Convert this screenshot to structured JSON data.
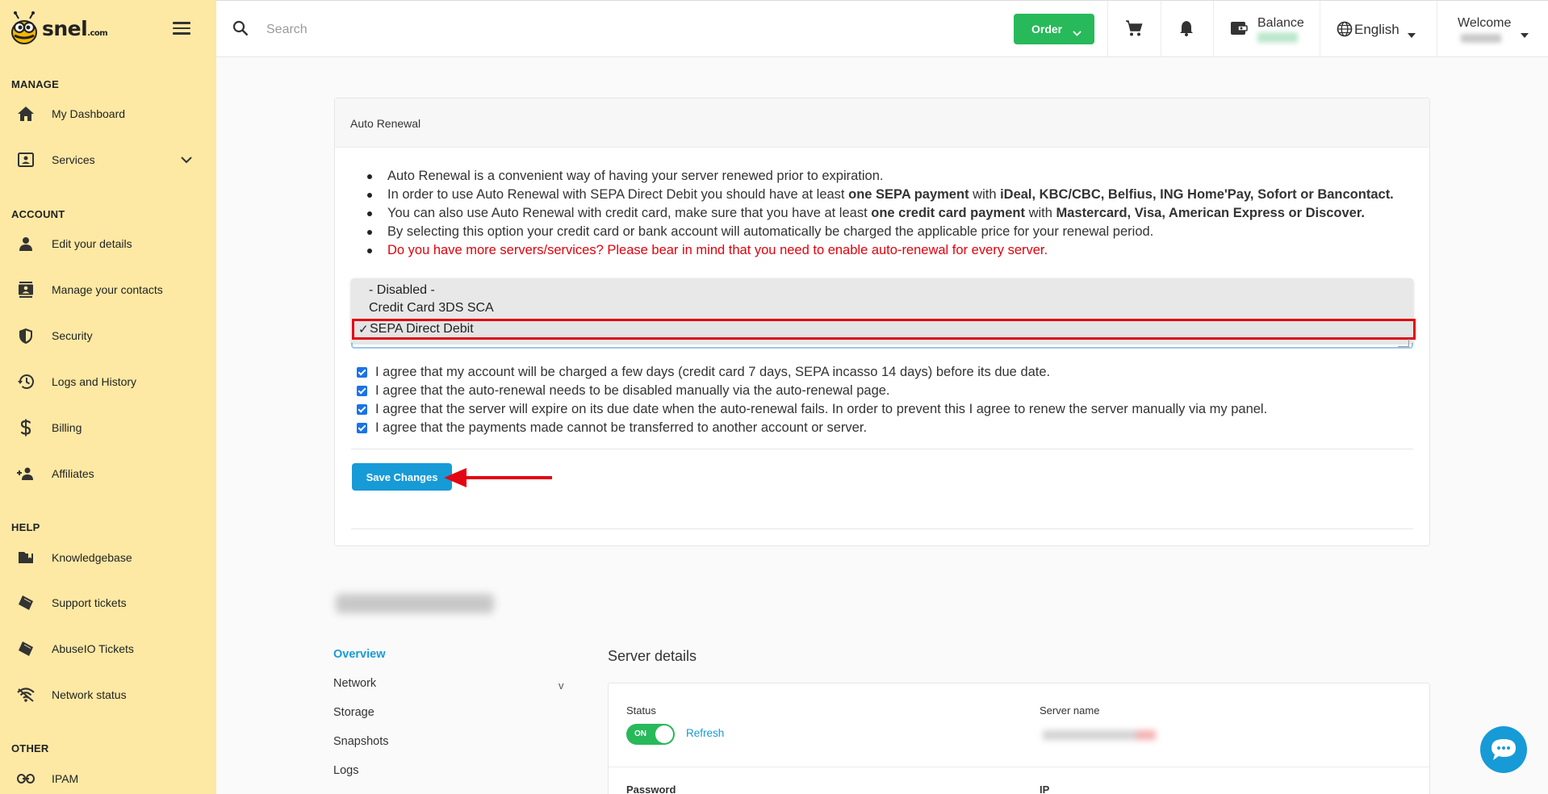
{
  "brand": {
    "name": "snel",
    "suffix": ".com"
  },
  "sidebar": {
    "sections": [
      {
        "title": "MANAGE"
      },
      {
        "title": "ACCOUNT"
      },
      {
        "title": "HELP"
      },
      {
        "title": "OTHER"
      }
    ],
    "items": [
      {
        "label": "My Dashboard",
        "icon": "home-icon"
      },
      {
        "label": "Services",
        "icon": "services-icon"
      },
      {
        "label": "Edit your details",
        "icon": "person-icon"
      },
      {
        "label": "Manage your contacts",
        "icon": "contacts-icon"
      },
      {
        "label": "Security",
        "icon": "shield-icon"
      },
      {
        "label": "Logs and History",
        "icon": "history-icon"
      },
      {
        "label": "Billing",
        "icon": "dollar-icon"
      },
      {
        "label": "Affiliates",
        "icon": "affiliates-icon"
      },
      {
        "label": "Knowledgebase",
        "icon": "folder-icon"
      },
      {
        "label": "Support tickets",
        "icon": "ticket-icon"
      },
      {
        "label": "AbuseIO Tickets",
        "icon": "ticket-icon"
      },
      {
        "label": "Network status",
        "icon": "wifi-icon"
      },
      {
        "label": "IPAM",
        "icon": "link-icon"
      }
    ]
  },
  "topbar": {
    "search_placeholder": "Search",
    "order_label": "Order",
    "balance_label": "Balance",
    "language": "English",
    "welcome_label": "Welcome"
  },
  "auto_renewal": {
    "title": "Auto Renewal",
    "bullets": {
      "b1": "Auto Renewal is a convenient way of having your server renewed prior to expiration.",
      "b2_pre": "In order to use Auto Renewal with SEPA Direct Debit you should have at least ",
      "b2_bold1": "one SEPA payment",
      "b2_mid": " with ",
      "b2_bold2": "iDeal, KBC/CBC, Belfius, ING Home'Pay, Sofort or Bancontact.",
      "b3_pre": "You can also use Auto Renewal with credit card, make sure that you have at least ",
      "b3_bold1": "one credit card payment",
      "b3_mid": " with ",
      "b3_bold2": "Mastercard, Visa, American Express or Discover.",
      "b4": "By selecting this option your credit card or bank account will automatically be charged the applicable price for your renewal period.",
      "b5": "Do you have more servers/services? Please bear in mind that you need to enable auto-renewal for every server."
    },
    "options": [
      "- Disabled -",
      "Credit Card 3DS SCA",
      "SEPA Direct Debit"
    ],
    "selected_check": "✓",
    "agreements": [
      "I agree that my account will be charged a few days (credit card 7 days, SEPA incasso 14 days) before its due date.",
      "I agree that the auto-renewal needs to be disabled manually via the auto-renewal page.",
      "I agree that the server will expire on its due date when the auto-renewal fails. In order to prevent this I agree to renew the server manually via my panel.",
      "I agree that the payments made cannot be transferred to another account or server."
    ],
    "save_label": "Save Changes"
  },
  "server_nav": {
    "items": [
      "Overview",
      "Network",
      "Storage",
      "Snapshots",
      "Logs"
    ],
    "network_chevron": "v"
  },
  "server_details": {
    "title": "Server details",
    "status_label": "Status",
    "toggle_text": "ON",
    "refresh_label": "Refresh",
    "server_name_label": "Server name",
    "password_label": "Password",
    "ip_label": "IP"
  },
  "colors": {
    "sidebar_bg": "#fde9a4",
    "accent_green": "#28b95a",
    "accent_blue": "#169bd7",
    "warning_red": "#e3000b",
    "highlight_red": "#e30613"
  }
}
